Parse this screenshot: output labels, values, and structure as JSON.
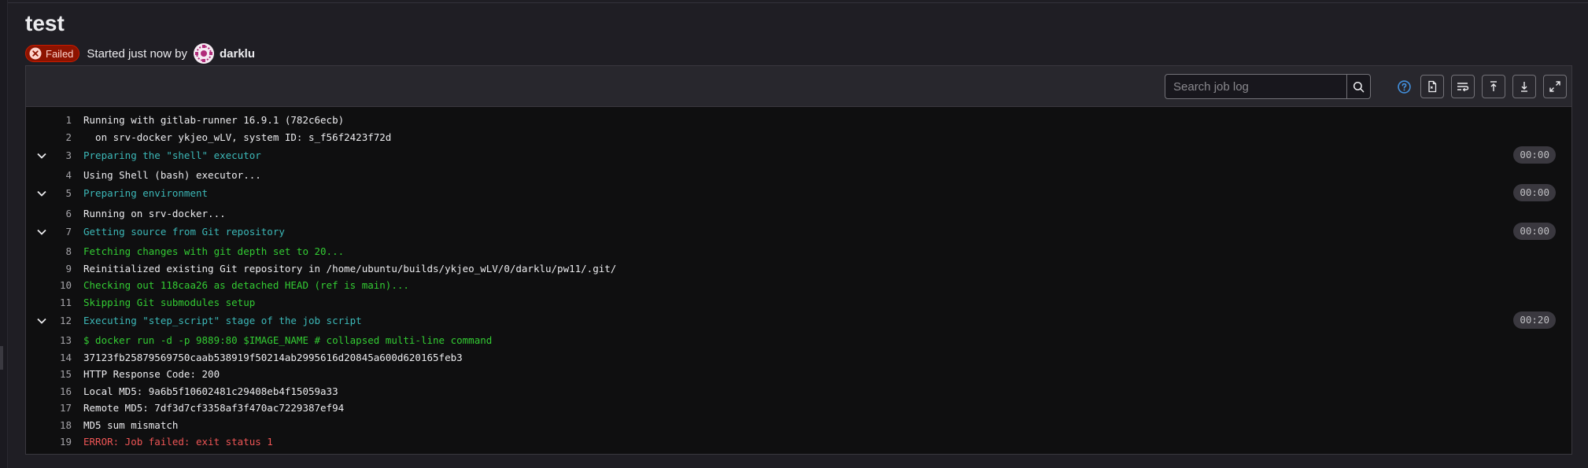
{
  "job": {
    "title": "test",
    "status": "Failed",
    "started_text": "Started just now by",
    "user": "darklu"
  },
  "toolbar": {
    "search_placeholder": "Search job log",
    "icons": [
      "search-icon",
      "help-icon",
      "raw-log-icon",
      "wrap-lines-icon",
      "scroll-top-icon",
      "scroll-bottom-icon",
      "fullscreen-icon"
    ]
  },
  "log": [
    {
      "n": "1",
      "text": "Running with gitlab-runner 16.9.1 (782c6ecb)",
      "color": "default"
    },
    {
      "n": "2",
      "text": "  on srv-docker ykjeo_wLV, system ID: s_f56f2423f72d",
      "color": "default"
    },
    {
      "n": "3",
      "text": "Preparing the \"shell\" executor",
      "color": "cyan",
      "section": true,
      "duration": "00:00"
    },
    {
      "n": "4",
      "text": "Using Shell (bash) executor...",
      "color": "default"
    },
    {
      "n": "5",
      "text": "Preparing environment",
      "color": "cyan",
      "section": true,
      "duration": "00:00"
    },
    {
      "n": "6",
      "text": "Running on srv-docker...",
      "color": "default"
    },
    {
      "n": "7",
      "text": "Getting source from Git repository",
      "color": "cyan",
      "section": true,
      "duration": "00:00"
    },
    {
      "n": "8",
      "text": "Fetching changes with git depth set to 20...",
      "color": "green"
    },
    {
      "n": "9",
      "text": "Reinitialized existing Git repository in /home/ubuntu/builds/ykjeo_wLV/0/darklu/pw11/.git/",
      "color": "default"
    },
    {
      "n": "10",
      "text": "Checking out 118caa26 as detached HEAD (ref is main)...",
      "color": "green"
    },
    {
      "n": "11",
      "text": "Skipping Git submodules setup",
      "color": "green"
    },
    {
      "n": "12",
      "text": "Executing \"step_script\" stage of the job script",
      "color": "cyan",
      "section": true,
      "duration": "00:20"
    },
    {
      "n": "13",
      "text": "$ docker run -d -p 9889:80 $IMAGE_NAME # collapsed multi-line command",
      "color": "green"
    },
    {
      "n": "14",
      "text": "37123fb25879569750caab538919f50214ab2995616d20845a600d620165feb3",
      "color": "default"
    },
    {
      "n": "15",
      "text": "HTTP Response Code: 200",
      "color": "default"
    },
    {
      "n": "16",
      "text": "Local MD5: 9a6b5f10602481c29408eb4f15059a33",
      "color": "default"
    },
    {
      "n": "17",
      "text": "Remote MD5: 7df3d7cf3358af3f470ac7229387ef94",
      "color": "default"
    },
    {
      "n": "18",
      "text": "MD5 sum mismatch",
      "color": "default"
    },
    {
      "n": "19",
      "text": "ERROR: Job failed: exit status 1",
      "color": "red"
    }
  ],
  "colors": {
    "failed_badge_bg": "#8d1300",
    "log_cyan": "#3cb8b8",
    "log_green": "#33cc33",
    "log_red": "#ee5555"
  }
}
